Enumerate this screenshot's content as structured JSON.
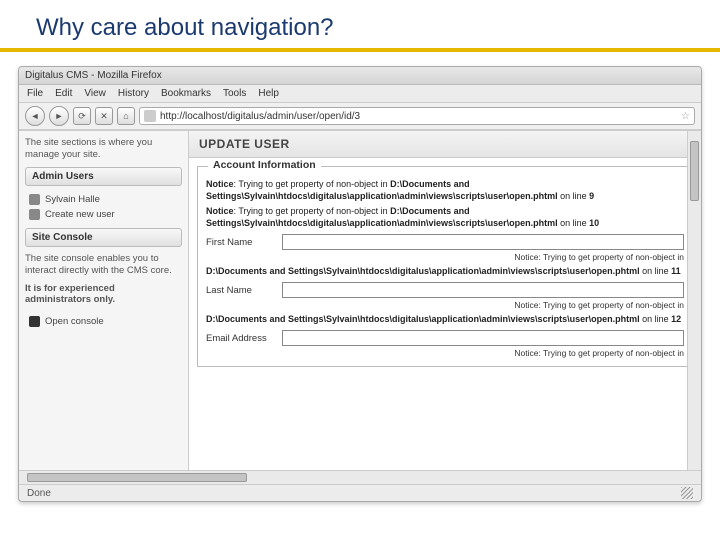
{
  "slide": {
    "title": "Why care about navigation?"
  },
  "browser": {
    "window_title": "Digitalus CMS - Mozilla Firefox",
    "menus": [
      "File",
      "Edit",
      "View",
      "History",
      "Bookmarks",
      "Tools",
      "Help"
    ],
    "url": "http://localhost/digitalus/admin/user/open/id/3",
    "status": "Done"
  },
  "sidebar": {
    "intro": "The site sections is where you manage your site.",
    "admin_header": "Admin Users",
    "admin_items": [
      "Sylvain Halle",
      "Create new user"
    ],
    "console_header": "Site Console",
    "console_intro": "The site console enables you to interact directly with the CMS core.",
    "console_warn": "It is for experienced administrators only.",
    "console_item": "Open console"
  },
  "page": {
    "title": "UPDATE USER",
    "fieldset_legend": "Account Information",
    "notices": {
      "n1a": "Notice",
      "n1b": ": Trying to get property of non-object in ",
      "n1c": "D:\\Documents and Settings\\Sylvain\\htdocs\\digitalus\\application\\admin\\views\\scripts\\user\\open.phtml",
      "n1d": " on line ",
      "n1e": "9",
      "n2e": "10",
      "n3path": "D:\\Documents and Settings\\Sylvain\\htdocs\\digitalus\\application\\admin\\views\\scripts\\user\\open.phtml",
      "n3line": "11",
      "n4line": "12",
      "side_notice": "Notice: Trying to get property of non-object in"
    },
    "labels": {
      "first_name": "First Name",
      "last_name": "Last Name",
      "email": "Email Address"
    }
  }
}
